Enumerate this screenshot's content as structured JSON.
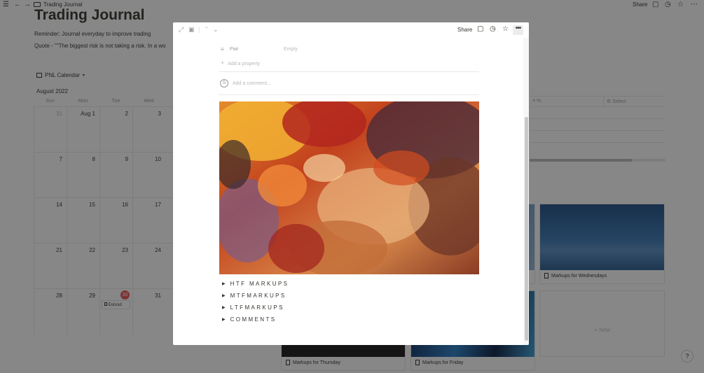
{
  "app": {
    "breadcrumb": "Trading Journal",
    "share_label": "Share"
  },
  "page": {
    "title": "Trading Journal",
    "reminder": "Reminder: Journal everyday to improve trading",
    "quote": "Quote - \"\"The biggest risk is not taking a risk. In a wo"
  },
  "calendar": {
    "view_label": "PNL Calendar",
    "month_label": "August 2022",
    "weekdays": [
      "Sun",
      "Mon",
      "Tue",
      "Wed"
    ],
    "weeks": [
      [
        "31",
        "Aug 1",
        "2",
        "3"
      ],
      [
        "7",
        "8",
        "9",
        "10"
      ],
      [
        "14",
        "15",
        "16",
        "17"
      ],
      [
        "21",
        "22",
        "23",
        "24"
      ],
      [
        "28",
        "29",
        "30",
        "31"
      ]
    ],
    "today": "30",
    "event_chip": "Eurusd"
  },
  "table": {
    "col_percent": "%",
    "col_select": "Select",
    "progress_fraction": 0.75
  },
  "gallery": {
    "cards": [
      {
        "label": "Markups for Wednesdays"
      },
      {
        "label": "Markups for Thursday"
      },
      {
        "label": "Markups for Friday"
      }
    ],
    "new_label": "+ New"
  },
  "modal": {
    "share_label": "Share",
    "property": {
      "name": "Pair",
      "value": "Empty"
    },
    "add_property": "Add a property",
    "comment_avatar": "S",
    "comment_placeholder": "Add a comment...",
    "toggles": [
      "HTF MARKUPS",
      "MTFMARKUPS",
      "LTFMARKUPS",
      "COMMENTS"
    ]
  },
  "help_label": "?",
  "icons": [
    "menu-icon",
    "back-arrow-icon",
    "forward-arrow-icon",
    "page-icon",
    "comment-icon",
    "clock-icon",
    "star-icon",
    "more-icon",
    "expand-icon",
    "open-page-icon",
    "chevron-up-icon",
    "chevron-down-icon",
    "toggle-arrow-icon",
    "document-icon",
    "list-icon",
    "plus-icon"
  ],
  "colors": {
    "overlay": "#0f0f0f80",
    "today_badge": "#eb5757",
    "text": "#37352f",
    "muted": "#9b9a97"
  }
}
